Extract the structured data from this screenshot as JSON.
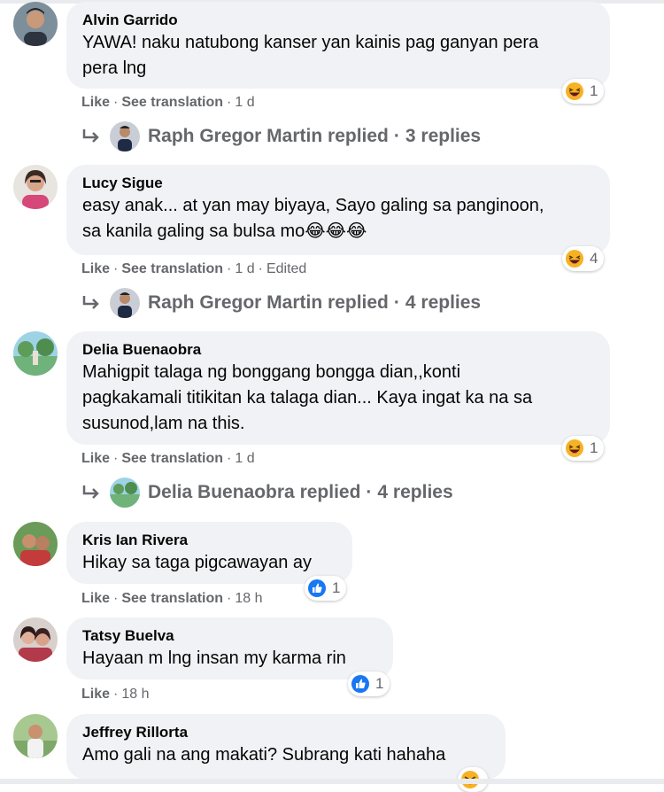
{
  "comments": [
    {
      "author": "Alvin Garrido",
      "text": "YAWA! naku natubong kanser yan kainis pag ganyan pera\npera lng",
      "actions": {
        "like": "Like",
        "translate": "See translation",
        "time": "1 d",
        "edited": ""
      },
      "reaction": {
        "icon": "haha-icon",
        "count": "1"
      },
      "replies": {
        "name": "Raph Gregor Martin",
        "verb": "replied",
        "count": "3 replies"
      }
    },
    {
      "author": "Lucy Sigue",
      "text": "easy anak... at yan may biyaya, Sayo galing sa panginoon,\nsa kanila galing sa bulsa mo😂😂😂",
      "actions": {
        "like": "Like",
        "translate": "See translation",
        "time": "1 d",
        "edited": "Edited"
      },
      "reaction": {
        "icon": "haha-icon",
        "count": "4"
      },
      "replies": {
        "name": "Raph Gregor Martin",
        "verb": "replied",
        "count": "4 replies"
      }
    },
    {
      "author": "Delia Buenaobra",
      "text": "Mahigpit talaga ng bonggang bongga dian,,konti\npagkakamali titikitan ka talaga dian... Kaya ingat ka na sa\nsusunod,lam na this.",
      "actions": {
        "like": "Like",
        "translate": "See translation",
        "time": "1 d",
        "edited": ""
      },
      "reaction": {
        "icon": "haha-icon",
        "count": "1"
      },
      "replies": {
        "name": "Delia Buenaobra",
        "verb": "replied",
        "count": "4 replies"
      }
    },
    {
      "author": "Kris Ian Rivera",
      "text": "Hikay sa taga pigcawayan ay",
      "actions": {
        "like": "Like",
        "translate": "See translation",
        "time": "18 h",
        "edited": ""
      },
      "reaction": {
        "icon": "like-icon",
        "count": "1"
      }
    },
    {
      "author": "Tatsy Buelva",
      "text": "Hayaan m lng insan my karma rin",
      "actions": {
        "like": "Like",
        "translate": "",
        "time": "18 h",
        "edited": ""
      },
      "reaction": {
        "icon": "like-icon",
        "count": "1"
      }
    },
    {
      "author": "Jeffrey Rillorta",
      "text": "Amo gali na ang makati? Subrang kati hahaha",
      "reaction": {
        "icon": "haha-icon",
        "count": ""
      }
    }
  ],
  "colors": {
    "bubble": "#f0f2f5",
    "meta": "#65676b",
    "like_blue": "#1877f2",
    "haha_yellow": "#f7b125"
  }
}
